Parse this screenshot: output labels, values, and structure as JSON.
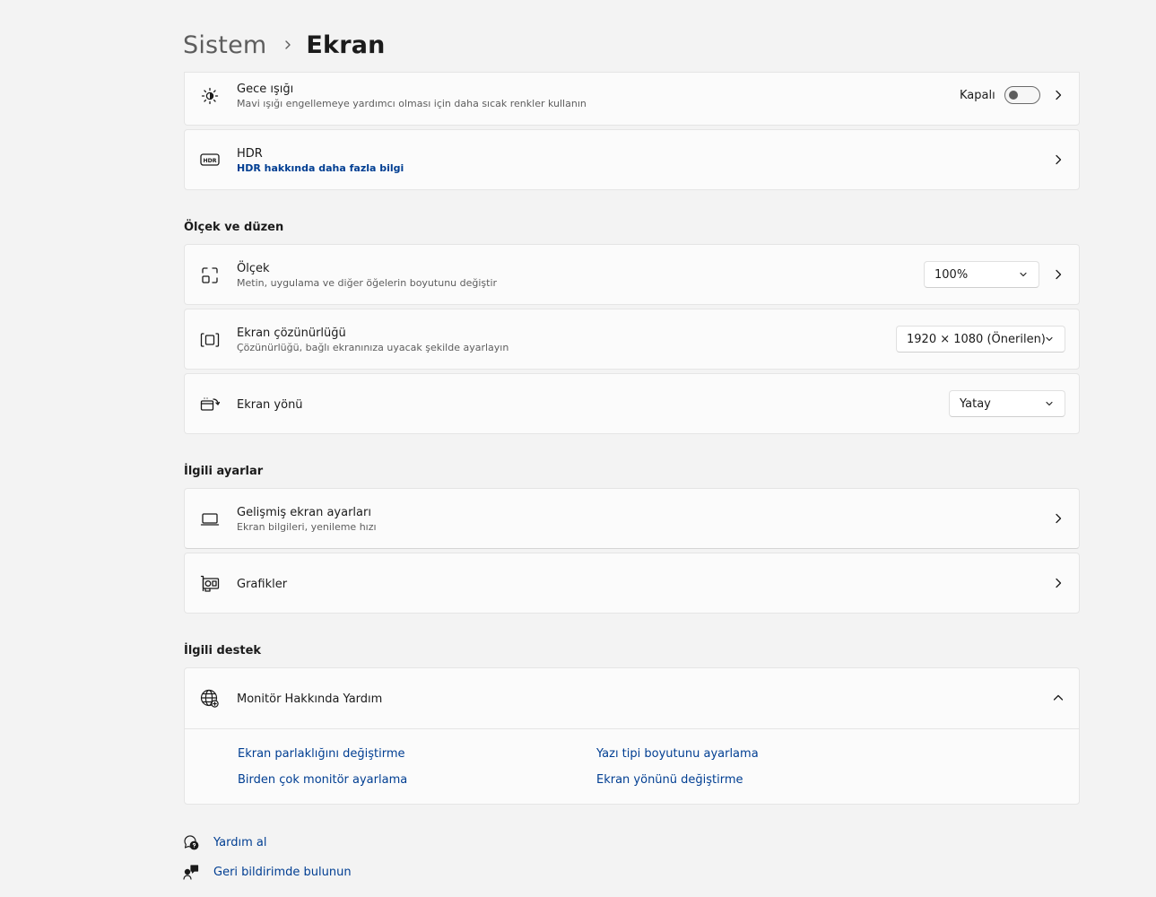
{
  "breadcrumb": {
    "parent": "Sistem",
    "current": "Ekran"
  },
  "night_light": {
    "title": "Gece ışığı",
    "subtitle": "Mavi ışığı engellemeye yardımcı olması için daha sıcak renkler kullanın",
    "state_label": "Kapalı",
    "toggle_on": false,
    "icon": "brightness-icon"
  },
  "hdr": {
    "title": "HDR",
    "link": "HDR hakkında daha fazla bilgi",
    "icon": "hdr-icon"
  },
  "scale_layout": {
    "section_label": "Ölçek ve düzen",
    "scale": {
      "title": "Ölçek",
      "subtitle": "Metin, uygulama ve diğer öğelerin boyutunu değiştir",
      "value": "100%",
      "icon": "scale-icon"
    },
    "resolution": {
      "title": "Ekran çözünürlüğü",
      "subtitle": "Çözünürlüğü, bağlı ekranınıza uyacak şekilde ayarlayın",
      "value": "1920 × 1080 (Önerilen)",
      "icon": "resolution-icon"
    },
    "orientation": {
      "title": "Ekran yönü",
      "value": "Yatay",
      "icon": "orientation-icon"
    }
  },
  "related_settings": {
    "section_label": "İlgili ayarlar",
    "advanced": {
      "title": "Gelişmiş ekran ayarları",
      "subtitle": "Ekran bilgileri, yenileme hızı",
      "icon": "laptop-icon"
    },
    "graphics": {
      "title": "Grafikler",
      "icon": "graphics-card-icon"
    }
  },
  "related_support": {
    "section_label": "İlgili destek",
    "expander": {
      "title": "Monitör Hakkında Yardım",
      "expanded": true,
      "icon": "globe-icon"
    },
    "links": [
      "Ekran parlaklığını değiştirme",
      "Yazı tipi boyutunu ayarlama",
      "Birden çok monitör ayarlama",
      "Ekran yönünü değiştirme"
    ]
  },
  "footer": {
    "get_help": "Yardım al",
    "feedback": "Geri bildirimde bulunun"
  },
  "colors": {
    "link": "#003e92",
    "background": "#f3f3f3",
    "card": "#fbfbfb"
  }
}
